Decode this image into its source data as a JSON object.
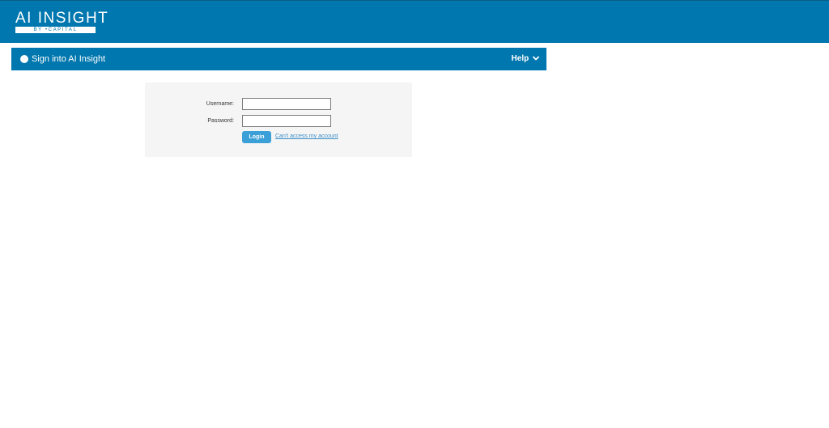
{
  "header": {
    "logo_title": "AI INSIGHT",
    "logo_subtitle": "BY  •CAPITAL",
    "color": "#0077ae"
  },
  "title_bar": {
    "title": "Sign into AI Insight",
    "help_label": "Help",
    "help_icon": "chevron-down-icon"
  },
  "login_form": {
    "username_label": "Username:",
    "username_value": "",
    "password_label": "Password:",
    "password_value": "",
    "login_button": "Login",
    "forgot_link": "Can't access my account",
    "accent_color": "#3b9fd8"
  }
}
